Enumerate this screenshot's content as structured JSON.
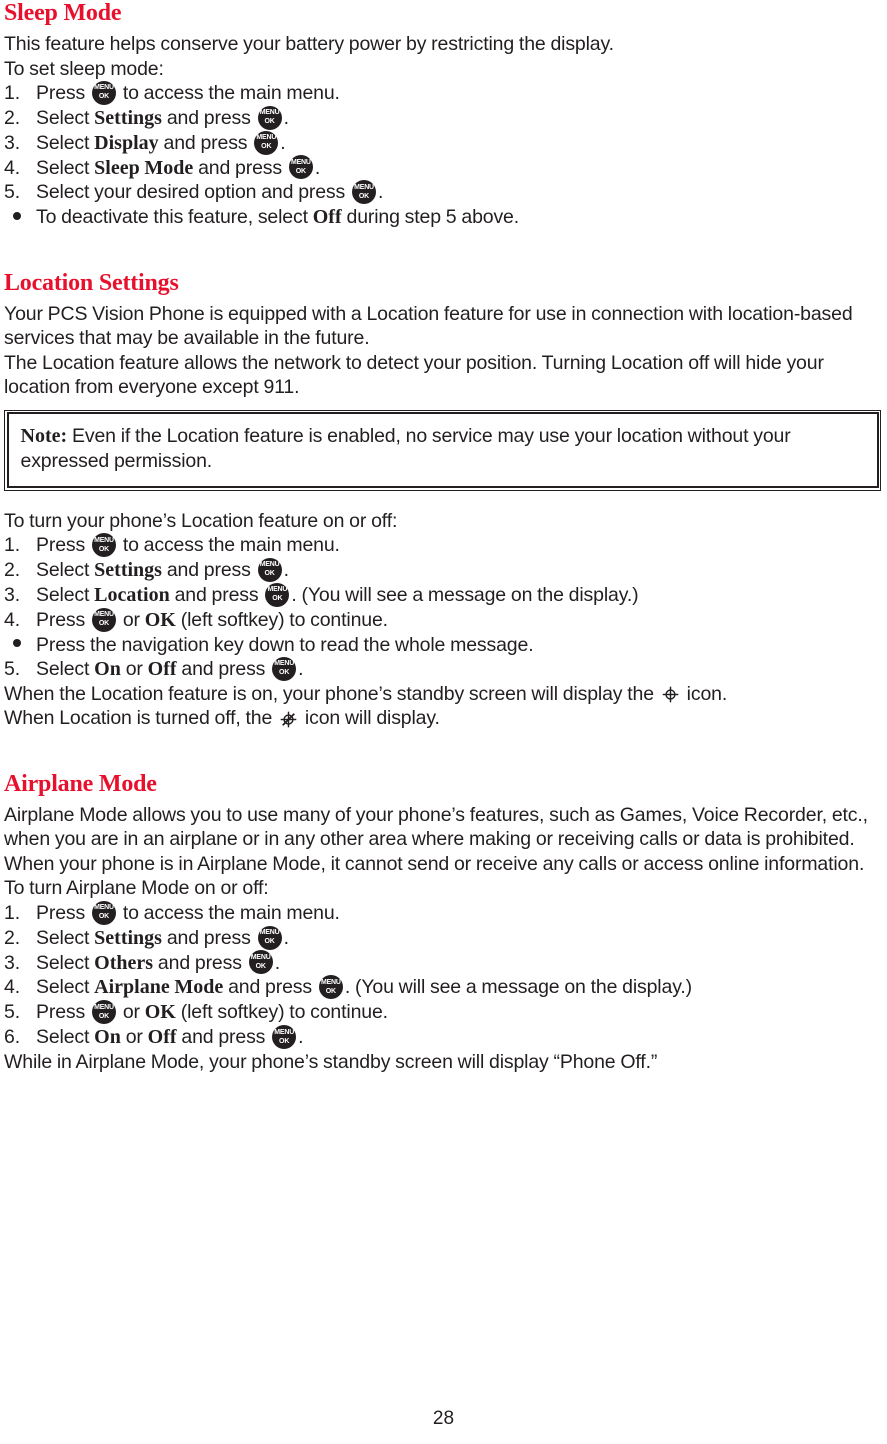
{
  "document": {
    "page_number": "28",
    "accent_color": "#e8112d",
    "text_color": "#231f20",
    "background_color": "#ffffff"
  },
  "icons": {
    "menu_ok_key": {
      "line1": "MENU",
      "line2": "OK",
      "name": "menu-ok-key-icon"
    },
    "location_on": "location-on-crosshair-icon",
    "location_off": "location-off-crosshair-slash-icon",
    "bullet": "bullet-dot-icon"
  },
  "sections": [
    {
      "id": "sleep-mode",
      "title": "Sleep Mode",
      "intro": [
        "This feature helps conserve your battery power by restricting the display.",
        "To set sleep mode:"
      ],
      "steps": [
        {
          "num": "1.",
          "pre": "Press ",
          "key": true,
          "post": " to access the main menu."
        },
        {
          "num": "2.",
          "pre": "Select ",
          "bold": "Settings",
          "mid": " and press ",
          "key": true,
          "post": "."
        },
        {
          "num": "3.",
          "pre": "Select ",
          "bold": "Display",
          "mid": " and press ",
          "key": true,
          "post": "."
        },
        {
          "num": "4.",
          "pre": "Select ",
          "bold": "Sleep Mode",
          "mid": " and press ",
          "key": true,
          "post": "."
        },
        {
          "num": "5.",
          "pre": "Select your desired option and press ",
          "key": true,
          "post": "."
        }
      ],
      "bullets": [
        {
          "pre": "To deactivate this feature, select ",
          "bold": "Off",
          "post": " during step 5 above."
        }
      ]
    },
    {
      "id": "location-settings",
      "title": "Location Settings",
      "intro": [
        "Your PCS Vision Phone is equipped with a Location feature for use in connection with location-based services that may be available in the future.",
        "The Location feature allows the network to detect your position. Turning Location off will hide your location from everyone except 911."
      ],
      "note": {
        "label": "Note:",
        "text": " Even if the Location feature is enabled, no service may use your location without your expressed permission."
      },
      "lead_in": "To turn your phone’s Location feature on or off:",
      "steps": [
        {
          "num": "1.",
          "pre": "Press ",
          "key": true,
          "post": " to access the main menu."
        },
        {
          "num": "2.",
          "pre": "Select ",
          "bold": "Settings",
          "mid": " and press ",
          "key": true,
          "post": "."
        },
        {
          "num": "3.",
          "pre": "Select ",
          "bold": "Location",
          "mid": " and press ",
          "key": true,
          "post": ". (You will see a message on the display.)"
        },
        {
          "num": "4.",
          "pre": "Press ",
          "key": true,
          "mid": " or ",
          "bold": "OK",
          "post": " (left softkey) to continue."
        },
        {
          "bulletmark": true,
          "pre": "Press the navigation key down to read the whole message."
        },
        {
          "num": "5.",
          "pre": "Select ",
          "bold": "On",
          "mid": " or ",
          "bold2": "Off",
          "mid2": " and press ",
          "key": true,
          "post": "."
        }
      ],
      "closing": [
        {
          "pre": "When the Location feature is on, your phone’s standby screen will display the ",
          "icon": "location_on",
          "post": " icon."
        },
        {
          "pre": "When Location is turned off, the ",
          "icon": "location_off",
          "post": " icon will display."
        }
      ]
    },
    {
      "id": "airplane-mode",
      "title": "Airplane Mode",
      "intro": [
        "Airplane Mode allows you to use many of your phone’s features, such as Games, Voice Recorder, etc., when you are in an airplane or in any other area where making or receiving calls or data is prohibited. When your phone is in Airplane Mode, it cannot send or receive any calls or access online information.",
        "To turn Airplane Mode on or off:"
      ],
      "steps": [
        {
          "num": "1.",
          "pre": "Press ",
          "key": true,
          "post": " to access the main menu."
        },
        {
          "num": "2.",
          "pre": "Select ",
          "bold": "Settings",
          "mid": " and press ",
          "key": true,
          "post": "."
        },
        {
          "num": "3.",
          "pre": "Select ",
          "bold": "Others",
          "mid": " and press ",
          "key": true,
          "post": "."
        },
        {
          "num": "4.",
          "pre": "Select ",
          "bold": "Airplane Mode",
          "mid": " and press ",
          "key": true,
          "post": ". (You will see a message on the display.)"
        },
        {
          "num": "5.",
          "pre": "Press ",
          "key": true,
          "mid": " or ",
          "bold": "OK",
          "post": " (left softkey) to continue."
        },
        {
          "num": "6.",
          "pre": "Select ",
          "bold": "On",
          "mid": " or ",
          "bold2": "Off",
          "mid2": " and press ",
          "key": true,
          "post": "."
        }
      ],
      "closing_text": "While in Airplane Mode, your phone’s standby screen will display “Phone Off.”"
    }
  ]
}
